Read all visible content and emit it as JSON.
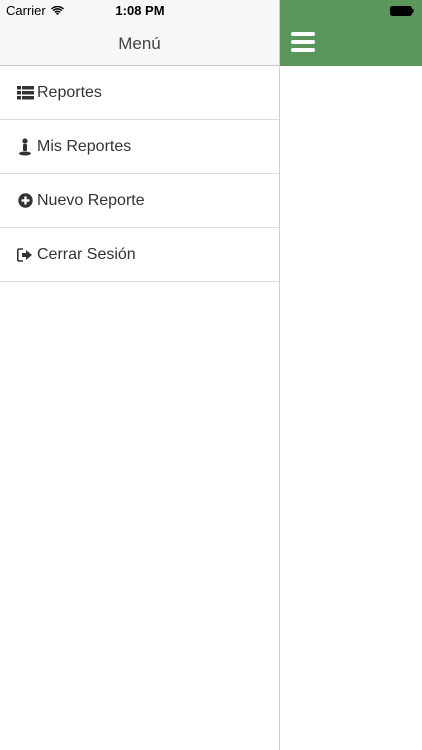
{
  "status_bar": {
    "carrier": "Carrier",
    "time": "1:08 PM"
  },
  "menu": {
    "title": "Menú",
    "items": [
      {
        "label": "Reportes",
        "icon": "list-icon"
      },
      {
        "label": "Mis Reportes",
        "icon": "map-pin-person-icon"
      },
      {
        "label": "Nuevo Reporte",
        "icon": "plus-circle-icon"
      },
      {
        "label": "Cerrar Sesión",
        "icon": "sign-out-icon"
      }
    ]
  },
  "colors": {
    "accent_green": "#5b965b",
    "header_bg": "#f7f7f7"
  }
}
